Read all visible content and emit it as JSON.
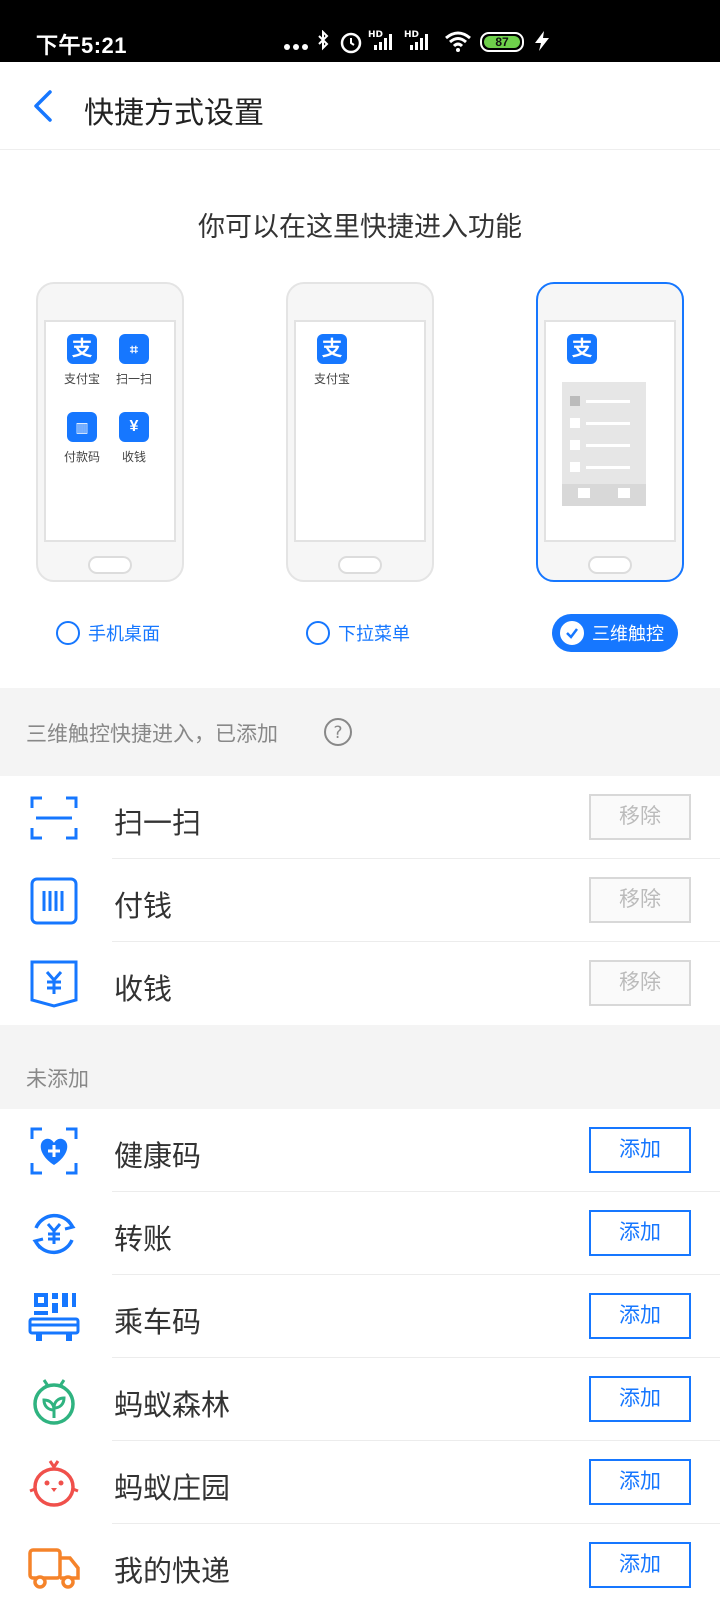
{
  "status": {
    "time": "下午5:21",
    "battery": "87"
  },
  "nav": {
    "title": "快捷方式设置"
  },
  "intro": "你可以在这里快捷进入功能",
  "desktop_apps": [
    "支付宝",
    "扫一扫",
    "付款码",
    "收钱"
  ],
  "dropdown_apps": [
    "支付宝"
  ],
  "options": [
    "手机桌面",
    "下拉菜单",
    "三维触控"
  ],
  "selected_option": "三维触控",
  "added_section": {
    "label": "三维触控快捷进入，已添加",
    "help_icon": "question-icon"
  },
  "added_items": [
    {
      "label": "扫一扫",
      "icon": "scan-icon",
      "action": "移除"
    },
    {
      "label": "付钱",
      "icon": "pay-code-icon",
      "action": "移除"
    },
    {
      "label": "收钱",
      "icon": "receive-money-icon",
      "action": "移除"
    }
  ],
  "not_added_section": {
    "label": "未添加"
  },
  "not_added_items": [
    {
      "label": "健康码",
      "icon": "health-code-icon",
      "action": "添加",
      "color": "#1677ff"
    },
    {
      "label": "转账",
      "icon": "transfer-icon",
      "action": "添加",
      "color": "#1677ff"
    },
    {
      "label": "乘车码",
      "icon": "transit-code-icon",
      "action": "添加",
      "color": "#1677ff"
    },
    {
      "label": "蚂蚁森林",
      "icon": "ant-forest-icon",
      "action": "添加",
      "color": "#2fb380"
    },
    {
      "label": "蚂蚁庄园",
      "icon": "ant-farm-icon",
      "action": "添加",
      "color": "#f0504b"
    },
    {
      "label": "我的快递",
      "icon": "delivery-icon",
      "action": "添加",
      "color": "#f5832a"
    }
  ],
  "colors": {
    "accent": "#1677ff",
    "section_bg": "#f4f4f4"
  }
}
